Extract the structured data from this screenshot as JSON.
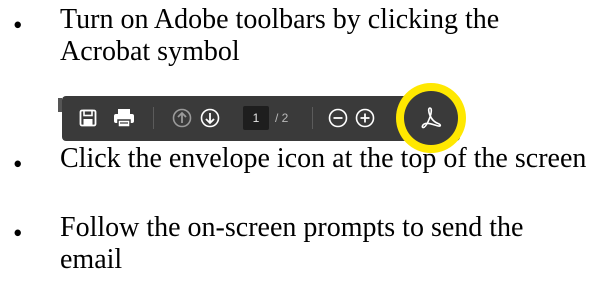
{
  "bullets": [
    {
      "symbol": "•",
      "text": "Turn on Adobe toolbars by clicking the Acrobat symbol"
    },
    {
      "symbol": "•",
      "text": "Click the envelope icon at the top of the screen"
    },
    {
      "symbol": "•",
      "text": "Follow the on-screen prompts to send the email"
    }
  ],
  "toolbar": {
    "icons": [
      "save-icon",
      "print-icon",
      "page-up-icon",
      "page-down-icon",
      "zoom-out-icon",
      "zoom-in-icon",
      "acrobat-icon"
    ],
    "current_page": "1",
    "page_total": "/ 2",
    "colors": {
      "toolbar_bg": "#3a3a3a",
      "highlight": "#ffe800",
      "icon": "#ffffff",
      "icon_dim": "#9a9a9a"
    }
  }
}
